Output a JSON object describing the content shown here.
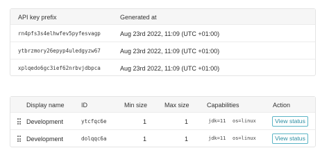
{
  "api_keys": {
    "columns": {
      "prefix": "API key prefix",
      "generated": "Generated at"
    },
    "rows": [
      {
        "prefix": "rn4pfs3s4elhwfev5pyfesvagp",
        "generated": "Aug 23rd 2022, 11:09 (UTC +01:00)"
      },
      {
        "prefix": "ytbrzmory26epyp4uledgyzw67",
        "generated": "Aug 23rd 2022, 11:09 (UTC +01:00)"
      },
      {
        "prefix": "xplqedo6gc3ief62nrbvjdbpca",
        "generated": "Aug 23rd 2022, 11:09 (UTC +01:00)"
      }
    ]
  },
  "pools": {
    "columns": {
      "display_name": "Display name",
      "id": "ID",
      "min_size": "Min size",
      "max_size": "Max size",
      "capabilities": "Capabilities",
      "action": "Action"
    },
    "rows": [
      {
        "display_name": "Development",
        "id": "ytcfqc6e",
        "min_size": "1",
        "max_size": "1",
        "cap_jdk": "jdk=11",
        "cap_os": "os=linux",
        "action": "View status"
      },
      {
        "display_name": "Development",
        "id": "dolqqc6a",
        "min_size": "1",
        "max_size": "1",
        "cap_jdk": "jdk=11",
        "cap_os": "os=linux",
        "action": "View status"
      }
    ],
    "drag_icon": "drag-handle-icon",
    "accent_color": "#2c8ea2"
  }
}
